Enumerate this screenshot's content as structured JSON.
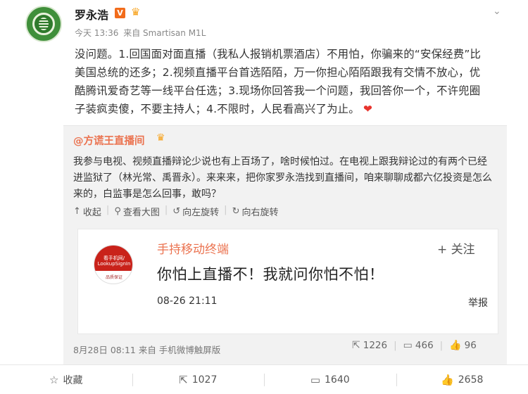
{
  "post": {
    "user_name": "罗永浩",
    "verified_badge": "V",
    "crown_icon": "crown-icon",
    "more_icon": "chevron-down-icon",
    "meta": {
      "time": "今天 13:36",
      "source": "来自 Smartisan M1L"
    },
    "text": "没问题。1.回国面对面直播（我私人报销机票酒店）不用怕，你骗来的“安保经费”比美国总统的还多；2.视频直播平台首选陌陌，万一你担心陌陌跟我有交情不放心，优酷腾讯爱奇艺等一线平台任选；3.现场你回答我一个问题，我回答你一个，不许兜圈子装疯卖傻，不要主持人；4.不限时，人民看高兴了为止。"
  },
  "repost": {
    "author": "@方谎王直播间",
    "text": "我参与电视、视频直播辩论少说也有上百场了，啥时候怕过。在电视上跟我辩论过的有两个已经进监狱了（林光常、禹晋永）。来来来，把你家罗永浩找到直播间，咱来聊聊成都六亿投资是怎么来的，白监事是怎么回事，敢吗？",
    "tools": {
      "collapse": "收起",
      "view_large": "查看大图",
      "rotate_left": "向左旋转",
      "rotate_right": "向右旋转"
    },
    "card": {
      "avatar_text": "看手机网/ LookupSignIn",
      "avatar_sub": "品质保证",
      "title": "手持移动终端",
      "follow": "+ 关注",
      "message": "你怕上直播不！我就问你怕不怕！",
      "time": "08-26 21:11",
      "report": "举报"
    },
    "meta": "8月28日 08:11 来自 手机微博触屏版",
    "stats": {
      "reposts": "1226",
      "comments": "466",
      "likes": "96"
    }
  },
  "actions": {
    "favorite": "收藏",
    "repost": "1027",
    "comment": "1640",
    "like": "2658"
  }
}
